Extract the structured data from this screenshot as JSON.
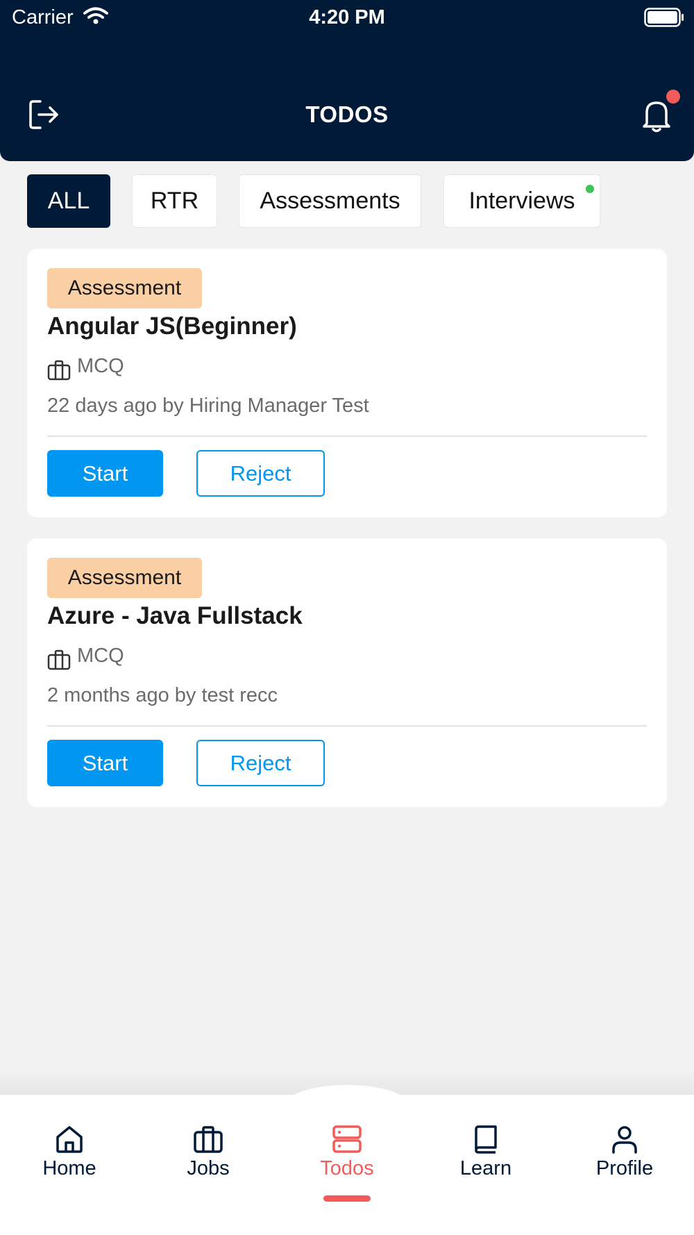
{
  "status_bar": {
    "carrier": "Carrier",
    "time": "4:20 PM"
  },
  "header": {
    "title": "TODOS",
    "notification_dot_color": "#f35b5b"
  },
  "tabs": [
    {
      "label": "ALL",
      "active": true
    },
    {
      "label": "RTR",
      "active": false
    },
    {
      "label": "Assessments",
      "active": false
    },
    {
      "label": "Interviews",
      "active": false,
      "has_dot": true
    }
  ],
  "todos": [
    {
      "badge": "Assessment",
      "title": "Angular JS(Beginner)",
      "type": "MCQ",
      "meta": "22 days ago by Hiring Manager Test",
      "start_label": "Start",
      "reject_label": "Reject"
    },
    {
      "badge": "Assessment",
      "title": "Azure - Java Fullstack",
      "type": "MCQ",
      "meta": "2 months ago by test recc",
      "start_label": "Start",
      "reject_label": "Reject"
    }
  ],
  "nav": [
    {
      "label": "Home",
      "icon": "home-icon"
    },
    {
      "label": "Jobs",
      "icon": "briefcase-icon"
    },
    {
      "label": "Todos",
      "icon": "server-icon",
      "active": true
    },
    {
      "label": "Learn",
      "icon": "book-icon"
    },
    {
      "label": "Profile",
      "icon": "user-icon"
    }
  ],
  "colors": {
    "header_bg": "#001a38",
    "primary": "#0096f2",
    "badge_bg": "#fbcfa4",
    "active_nav": "#f35b5b",
    "online_dot": "#3cc456"
  }
}
